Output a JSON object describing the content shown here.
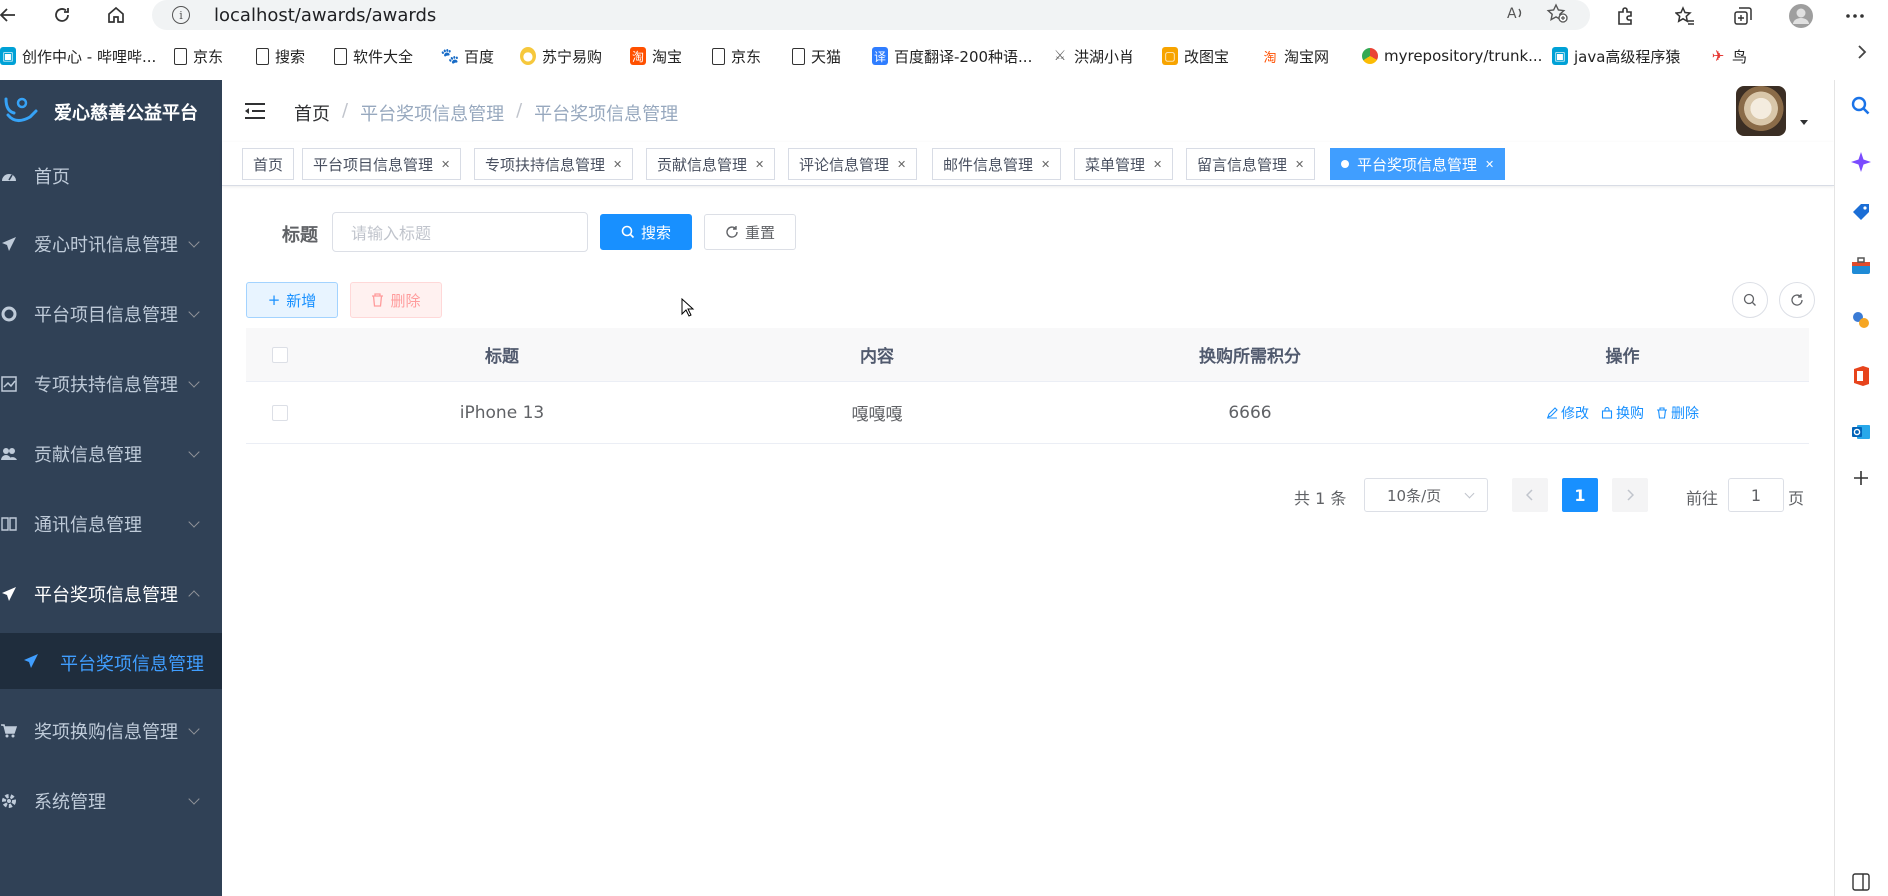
{
  "browser": {
    "url": "localhost/awards/awards",
    "bookmarks": [
      {
        "label": "创作中心 - 哔哩哔...",
        "icon": "bilibili-icon"
      },
      {
        "label": "京东",
        "icon": "page-icon"
      },
      {
        "label": "搜索",
        "icon": "page-icon"
      },
      {
        "label": "软件大全",
        "icon": "page-icon"
      },
      {
        "label": "百度",
        "icon": "baidu-icon"
      },
      {
        "label": "苏宁易购",
        "icon": "suning-icon"
      },
      {
        "label": "淘宝",
        "icon": "taobao-icon"
      },
      {
        "label": "京东",
        "icon": "page-icon"
      },
      {
        "label": "天猫",
        "icon": "page-icon"
      },
      {
        "label": "百度翻译-200种语...",
        "icon": "translate-icon"
      },
      {
        "label": "洪湖小肖",
        "icon": "wolf-icon"
      },
      {
        "label": "改图宝",
        "icon": "gaitubao-icon"
      },
      {
        "label": "淘宝网",
        "icon": "taobao-icon"
      },
      {
        "label": "myrepository/trunk...",
        "icon": "chrome-icon"
      },
      {
        "label": "java高级程序猿",
        "icon": "bilibili-icon"
      },
      {
        "label": "鸟",
        "icon": "bird-icon"
      }
    ]
  },
  "sidebar": {
    "title": "爱心慈善公益平台",
    "items": [
      {
        "label": "首页",
        "icon": "dashboard-icon"
      },
      {
        "label": "爱心时讯信息管理",
        "icon": "paper-plane-icon"
      },
      {
        "label": "平台项目信息管理",
        "icon": "lifebuoy-icon"
      },
      {
        "label": "专项扶持信息管理",
        "icon": "chart-icon"
      },
      {
        "label": "贡献信息管理",
        "icon": "users-icon"
      },
      {
        "label": "通讯信息管理",
        "icon": "book-icon"
      },
      {
        "label": "平台奖项信息管理",
        "icon": "paper-plane-icon"
      },
      {
        "label": "奖项换购信息管理",
        "icon": "cart-icon"
      },
      {
        "label": "系统管理",
        "icon": "gear-icon"
      }
    ],
    "sub_item": "平台奖项信息管理"
  },
  "breadcrumb": [
    "首页",
    "平台奖项信息管理",
    "平台奖项信息管理"
  ],
  "tags": [
    {
      "label": "首页",
      "closable": false
    },
    {
      "label": "平台项目信息管理",
      "closable": true
    },
    {
      "label": "专项扶持信息管理",
      "closable": true
    },
    {
      "label": "贡献信息管理",
      "closable": true
    },
    {
      "label": "评论信息管理",
      "closable": true
    },
    {
      "label": "邮件信息管理",
      "closable": true
    },
    {
      "label": "菜单管理",
      "closable": true
    },
    {
      "label": "留言信息管理",
      "closable": true
    },
    {
      "label": "平台奖项信息管理",
      "closable": true,
      "active": true
    }
  ],
  "search": {
    "label": "标题",
    "placeholder": "请输入标题",
    "search_btn": "搜索",
    "reset_btn": "重置"
  },
  "toolbar": {
    "add_btn": "新增",
    "delete_btn": "删除"
  },
  "table": {
    "columns": [
      "标题",
      "内容",
      "换购所需积分",
      "操作"
    ],
    "rows": [
      {
        "title": "iPhone 13",
        "content": "嘎嘎嘎",
        "points": "6666"
      }
    ],
    "actions": [
      "修改",
      "换购",
      "删除"
    ]
  },
  "pagination": {
    "total": "共 1 条",
    "page_size": "10条/页",
    "current": "1",
    "goto_label": "前往",
    "goto_value": "1",
    "page_suffix": "页"
  },
  "colors": {
    "sidebar_bg": "#304156",
    "primary": "#1890ff",
    "active_tag": "#409eff"
  }
}
